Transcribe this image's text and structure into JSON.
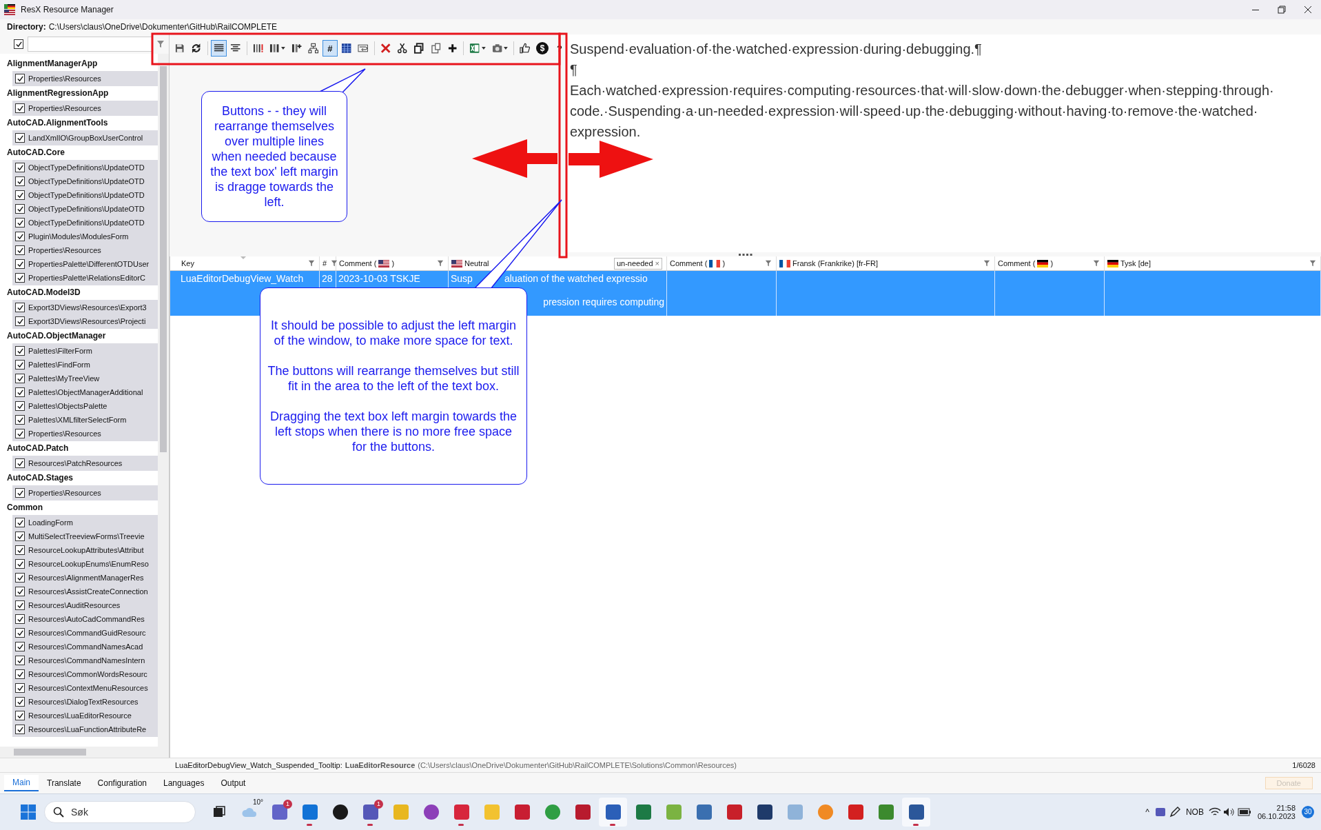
{
  "window": {
    "title": "ResX Resource Manager"
  },
  "directory": {
    "label": "Directory:",
    "path": "C:\\Users\\claus\\OneDrive\\Dokumenter\\GitHub\\RailCOMPLETE"
  },
  "sidebar": {
    "select_all": {
      "checked": true
    },
    "groups": [
      {
        "name": "AlignmentManagerApp",
        "items": [
          {
            "label": "Properties\\Resources",
            "checked": true
          }
        ]
      },
      {
        "name": "AlignmentRegressionApp",
        "items": [
          {
            "label": "Properties\\Resources",
            "checked": true
          }
        ]
      },
      {
        "name": "AutoCAD.AlignmentTools",
        "items": [
          {
            "label": "LandXmlIO\\GroupBoxUserControl",
            "checked": true
          }
        ]
      },
      {
        "name": "AutoCAD.Core",
        "items": [
          {
            "label": "ObjectTypeDefinitions\\UpdateOTD",
            "checked": true
          },
          {
            "label": "ObjectTypeDefinitions\\UpdateOTD",
            "checked": true
          },
          {
            "label": "ObjectTypeDefinitions\\UpdateOTD",
            "checked": true
          },
          {
            "label": "ObjectTypeDefinitions\\UpdateOTD",
            "checked": true
          },
          {
            "label": "ObjectTypeDefinitions\\UpdateOTD",
            "checked": true
          },
          {
            "label": "Plugin\\Modules\\ModulesForm",
            "checked": true
          },
          {
            "label": "Properties\\Resources",
            "checked": true
          },
          {
            "label": "PropertiesPalette\\DifferentOTDUser",
            "checked": true
          },
          {
            "label": "PropertiesPalette\\RelationsEditorC",
            "checked": true
          }
        ]
      },
      {
        "name": "AutoCAD.Model3D",
        "items": [
          {
            "label": "Export3DViews\\Resources\\Export3",
            "checked": true
          },
          {
            "label": "Export3DViews\\Resources\\Projecti",
            "checked": true
          }
        ]
      },
      {
        "name": "AutoCAD.ObjectManager",
        "items": [
          {
            "label": "Palettes\\FilterForm",
            "checked": true
          },
          {
            "label": "Palettes\\FindForm",
            "checked": true
          },
          {
            "label": "Palettes\\MyTreeView",
            "checked": true
          },
          {
            "label": "Palettes\\ObjectManagerAdditional",
            "checked": true
          },
          {
            "label": "Palettes\\ObjectsPalette",
            "checked": true
          },
          {
            "label": "Palettes\\XMLfilterSelectForm",
            "checked": true
          },
          {
            "label": "Properties\\Resources",
            "checked": true
          }
        ]
      },
      {
        "name": "AutoCAD.Patch",
        "items": [
          {
            "label": "Resources\\PatchResources",
            "checked": true
          }
        ]
      },
      {
        "name": "AutoCAD.Stages",
        "items": [
          {
            "label": "Properties\\Resources",
            "checked": true
          }
        ]
      },
      {
        "name": "Common",
        "items": [
          {
            "label": "LoadingForm",
            "checked": true
          },
          {
            "label": "MultiSelectTreeviewForms\\Treevie",
            "checked": true
          },
          {
            "label": "ResourceLookupAttributes\\Attribut",
            "checked": true
          },
          {
            "label": "ResourceLookupEnums\\EnumReso",
            "checked": true
          },
          {
            "label": "Resources\\AlignmentManagerRes",
            "checked": true
          },
          {
            "label": "Resources\\AssistCreateConnection",
            "checked": true
          },
          {
            "label": "Resources\\AuditResources",
            "checked": true
          },
          {
            "label": "Resources\\AutoCadCommandRes",
            "checked": true
          },
          {
            "label": "Resources\\CommandGuidResourc",
            "checked": true
          },
          {
            "label": "Resources\\CommandNamesAcad",
            "checked": true
          },
          {
            "label": "Resources\\CommandNamesIntern",
            "checked": true
          },
          {
            "label": "Resources\\CommonWordsResourc",
            "checked": true
          },
          {
            "label": "Resources\\ContextMenuResources",
            "checked": true
          },
          {
            "label": "Resources\\DialogTextResources",
            "checked": true
          },
          {
            "label": "Resources\\LuaEditorResource",
            "checked": true
          },
          {
            "label": "Resources\\LuaFunctionAttributeRe",
            "checked": true
          }
        ]
      }
    ]
  },
  "toolbar": {
    "groups": [
      [
        {
          "kind": "save",
          "selected": false
        },
        {
          "kind": "refresh",
          "selected": false
        }
      ],
      [
        {
          "kind": "lines",
          "selected": true
        },
        {
          "kind": "align-center",
          "selected": false
        }
      ],
      [
        {
          "kind": "columns-warn",
          "selected": false
        },
        {
          "kind": "columns",
          "selected": false,
          "dropdown": true
        },
        {
          "kind": "column-add",
          "selected": false
        },
        {
          "kind": "hierarchy",
          "selected": false
        },
        {
          "kind": "text",
          "label": "#",
          "selected": true
        },
        {
          "kind": "grid",
          "selected": false
        },
        {
          "kind": "wrap",
          "selected": false
        }
      ],
      [
        {
          "kind": "delete",
          "selected": false
        },
        {
          "kind": "cut",
          "selected": false
        },
        {
          "kind": "copy",
          "selected": false
        },
        {
          "kind": "paste",
          "selected": false
        },
        {
          "kind": "add",
          "selected": false
        }
      ],
      [
        {
          "kind": "excel",
          "selected": false,
          "dropdown": true
        },
        {
          "kind": "camera",
          "selected": false,
          "dropdown": true
        }
      ],
      [
        {
          "kind": "thumbs-up",
          "selected": false
        },
        {
          "kind": "coin",
          "label": "$",
          "selected": false
        },
        {
          "kind": "text",
          "label": "?",
          "selected": false
        }
      ]
    ]
  },
  "editor": {
    "paragraphs": [
      "Suspend·evaluation·of·the·watched·expression·during·debugging.¶",
      "¶",
      "Each·watched·expression·requires·computing·resources·that·will·slow·down·the·debugger·when·stepping·through·code.·Suspending·a·un-needed·expression·will·speed·up·the·debugging·without·having·to·remove·the·watched·expression."
    ]
  },
  "grid": {
    "columns": [
      {
        "kind": "text",
        "label": "Key",
        "sorted": true
      },
      {
        "kind": "text",
        "label": "#",
        "sorted": false
      },
      {
        "kind": "comment",
        "label": "Comment (",
        "suffix": ")",
        "flag": {
          "kind": "us"
        }
      },
      {
        "kind": "language",
        "label": "Neutral",
        "flag": {
          "kind": "us"
        },
        "filter_value": "un-needed",
        "clear": "×"
      },
      {
        "kind": "comment",
        "label": "Comment (",
        "suffix": ")",
        "flag": {
          "kind": "fr"
        }
      },
      {
        "kind": "language",
        "label": "Fransk (Frankrike) [fr-FR]",
        "flag": {
          "kind": "fr"
        }
      },
      {
        "kind": "comment",
        "label": "Comment (",
        "suffix": ")",
        "flag": {
          "kind": "de"
        }
      },
      {
        "kind": "language",
        "label": "Tysk [de]",
        "flag": {
          "kind": "de"
        }
      }
    ],
    "rows": [
      {
        "selected": true,
        "key": "LuaEditorDebugView_Watch",
        "number": "28",
        "comment": "2023-10-03 TSKJE",
        "neutral_parts": [
          "Susp",
          "aluation of the watched expressio"
        ],
        "neutral_line_2": "pression requires computing"
      }
    ]
  },
  "callouts": [
    {
      "paragraphs": [
        "Buttons - - they will rearrange themselves over multiple lines when needed because the text box' left margin is dragge towards the left."
      ]
    },
    {
      "paragraphs": [
        "It should be possible to adjust the left margin of the window, to make more space for text.",
        "The buttons will rearrange themselves but still fit in the area to the left of the text box.",
        "Dragging the text box left margin towards the left stops when there is no more free space for the buttons."
      ]
    }
  ],
  "status_bar": {
    "key": "LuaEditorDebugView_Watch_Suspended_Tooltip:",
    "resource": "LuaEditorResource",
    "path": "(C:\\Users\\claus\\OneDrive\\Dokumenter\\GitHub\\RailCOMPLETE\\Solutions\\Common\\Resources)",
    "position": "1/6028"
  },
  "tabs": [
    {
      "label": "Main",
      "selected": true
    },
    {
      "label": "Translate",
      "selected": false
    },
    {
      "label": "Configuration",
      "selected": false
    },
    {
      "label": "Languages",
      "selected": false
    },
    {
      "label": "Output",
      "selected": false
    }
  ],
  "donate_button": {
    "label": "Donate",
    "disabled": true
  },
  "taskbar": {
    "search_placeholder": "Søk",
    "apps": [
      {
        "kind": "task-view",
        "running": false,
        "active": false
      },
      {
        "kind": "weather",
        "label": "10°",
        "running": false,
        "active": false
      },
      {
        "kind": "app",
        "color": "#6264c8",
        "badge": "1",
        "running": false,
        "active": false
      },
      {
        "kind": "app",
        "color": "#1172d6",
        "running": true,
        "active": false
      },
      {
        "kind": "disc",
        "color": "#1a1a1a",
        "running": false,
        "active": false
      },
      {
        "kind": "app",
        "color": "#5558b8",
        "badge": "1",
        "running": true,
        "active": false
      },
      {
        "kind": "app",
        "color": "#e8b720",
        "running": false,
        "active": false
      },
      {
        "kind": "disc",
        "color": "#8c3fb8",
        "running": false,
        "active": false
      },
      {
        "kind": "app",
        "color": "#d7263d",
        "running": true,
        "active": false
      },
      {
        "kind": "app",
        "color": "#f2c230",
        "running": false,
        "active": false
      },
      {
        "kind": "app",
        "color": "#c81e32",
        "running": false,
        "active": false
      },
      {
        "kind": "disc",
        "color": "#2f9e44",
        "running": false,
        "active": false
      },
      {
        "kind": "app",
        "color": "#b81b2e",
        "running": false,
        "active": false
      },
      {
        "kind": "app",
        "color": "#2b5fb8",
        "running": true,
        "active": true
      },
      {
        "kind": "app",
        "color": "#1d7a45",
        "running": false,
        "active": false
      },
      {
        "kind": "app",
        "color": "#7bb342",
        "running": false,
        "active": false
      },
      {
        "kind": "app",
        "color": "#3a6fb0",
        "running": false,
        "active": false
      },
      {
        "kind": "app",
        "color": "#c8202a",
        "running": false,
        "active": false
      },
      {
        "kind": "app",
        "color": "#1f3a6a",
        "running": false,
        "active": false
      },
      {
        "kind": "app",
        "color": "#8fb3d9",
        "running": false,
        "active": false
      },
      {
        "kind": "disc",
        "color": "#f08a24",
        "running": false,
        "active": false
      },
      {
        "kind": "app",
        "color": "#d32020",
        "running": false,
        "active": false
      },
      {
        "kind": "app",
        "color": "#3c8a2e",
        "running": false,
        "active": false
      },
      {
        "kind": "app",
        "color": "#2b579a",
        "running": true,
        "active": true
      }
    ],
    "tray": {
      "chevron": "^",
      "language": "NOB",
      "time": "21:58",
      "date": "06.10.2023",
      "notifications": "30"
    }
  }
}
